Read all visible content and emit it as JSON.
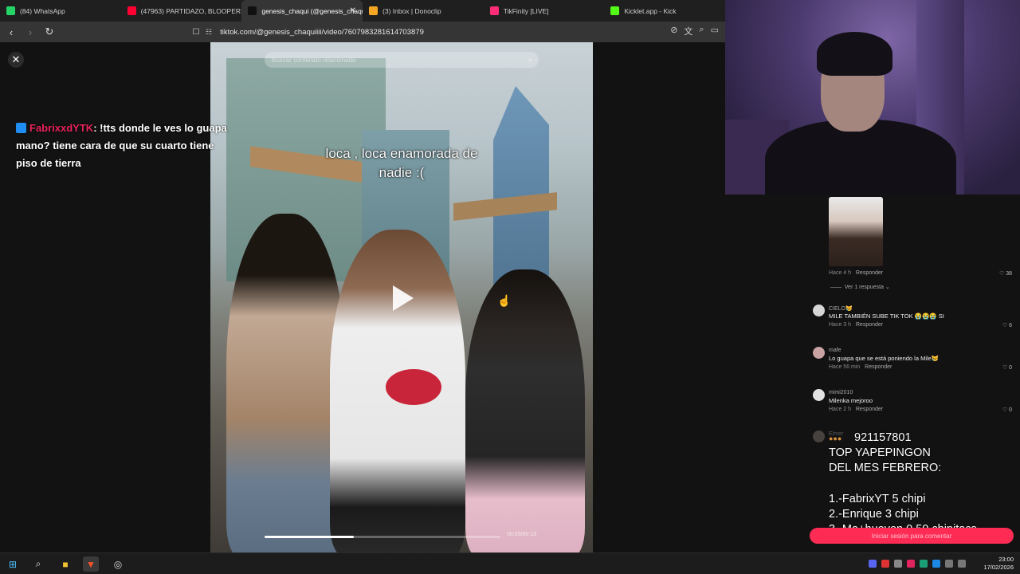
{
  "browser": {
    "tabs": [
      {
        "title": "(84) WhatsApp",
        "icon": "whatsapp-icon",
        "color": "#25d366",
        "active": false
      },
      {
        "title": "(47963) PARTIDAZO, BLOOPERS Y EM",
        "icon": "youtube-icon",
        "color": "#ff0033",
        "active": false
      },
      {
        "title": "genesis_chaqui (@genesis_chaqu",
        "icon": "tiktok-icon",
        "color": "#111111",
        "active": true
      },
      {
        "title": "(3) Inbox | Donoclip",
        "icon": "donoclip-icon",
        "color": "#f5a623",
        "active": false
      },
      {
        "title": "TikFinity [LIVE]",
        "icon": "tikfinity-icon",
        "color": "#ff2d78",
        "active": false
      },
      {
        "title": "Kicklet.app - Kick",
        "icon": "kicklet-icon",
        "color": "#53fc18",
        "active": false
      }
    ],
    "url": "tiktok.com/@genesis_chaquiiii/video/7607983281614703879"
  },
  "chat_overlay": {
    "username": "FabrixxdYTK",
    "message": ": !tts donde le ves lo guapa mano? tiene cara de que su cuarto tiene piso de tierra"
  },
  "video": {
    "search_placeholder": "Buscar contenido relacionado",
    "caption": "loca , loca enamorada de\nnadie :(",
    "timecode": "00:05/00:13",
    "progress": 0.38
  },
  "comments": {
    "first": {
      "time": "Hace 4 h",
      "reply": "Responder",
      "likes": "38",
      "view_replies": "Ver 1 respuesta"
    },
    "items": [
      {
        "name": "CIELO😿",
        "text": "MILE TAMBIÉN SUBE TIK TOK 😭😭😭 SI",
        "time": "Hace 3 h",
        "reply": "Responder",
        "likes": "6",
        "avatar_color": "#d6d6d6"
      },
      {
        "name": "mafe",
        "text": "Lo guapa que se está poniendo la Mile😿",
        "time": "Hace 56 min",
        "reply": "Responder",
        "likes": "0",
        "avatar_color": "#c9a3a3"
      },
      {
        "name": "mimi2010",
        "text": "Milenka mejoroo",
        "time": "Hace 2 h",
        "reply": "Responder",
        "likes": "0",
        "avatar_color": "#e2e2e2"
      },
      {
        "name": "Elmer",
        "text": "",
        "time": "",
        "reply": "",
        "likes": "",
        "avatar_color": "#8a7d74"
      }
    ],
    "login_button": "Iniciar sesión para comentar"
  },
  "stream_overlay": {
    "number": "921157801",
    "lines": [
      "TOP YAPEPINGON",
      "DEL MES FEBRERO:",
      "1.-FabrixYT 5 chipi",
      "2.-Enrique 3 chipi",
      "3.-Ma+huevon 0.50 chipitacs"
    ]
  },
  "taskbar": {
    "time": "23:00",
    "date": "17/02/2026"
  }
}
